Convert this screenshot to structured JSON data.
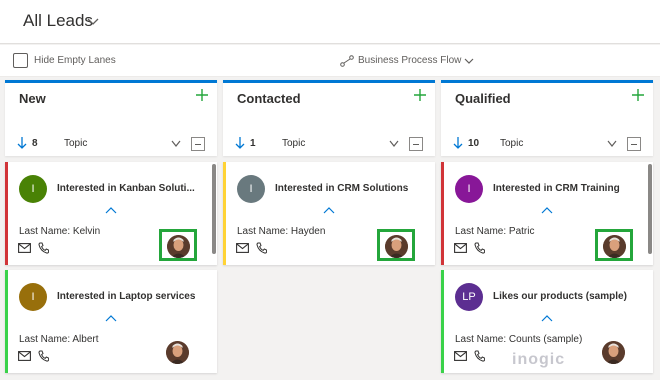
{
  "header": {
    "view_title": "All Leads"
  },
  "toolbar": {
    "hide_empty_lanes": "Hide Empty Lanes",
    "bpf_label": "Business Process Flow"
  },
  "colors": {
    "accent": "#0078d4",
    "highlight": "#24a63b",
    "red": "#d13438",
    "yellow": "#ffd335",
    "green": "#3ad24a"
  },
  "lanes": [
    {
      "title": "New",
      "count": "8",
      "sort_field": "Topic",
      "cards": [
        {
          "initials": "I",
          "avatar_color": "#498205",
          "title": "Interested in Kanban Soluti...",
          "field": "Last Name: Kelvin",
          "edge_color": "#d13438",
          "highlighted": true
        },
        {
          "initials": "I",
          "avatar_color": "#986f0b",
          "title": "Interested in Laptop services",
          "field": "Last Name: Albert",
          "edge_color": "#3ad24a",
          "highlighted": false
        }
      ]
    },
    {
      "title": "Contacted",
      "count": "1",
      "sort_field": "Topic",
      "cards": [
        {
          "initials": "I",
          "avatar_color": "#69797e",
          "title": "Interested in CRM Solutions",
          "field": "Last Name: Hayden",
          "edge_color": "#ffd335",
          "highlighted": true
        }
      ]
    },
    {
      "title": "Qualified",
      "count": "10",
      "sort_field": "Topic",
      "cards": [
        {
          "initials": "I",
          "avatar_color": "#881798",
          "title": "Interested in CRM Training",
          "field": "Last Name: Patric",
          "edge_color": "#d13438",
          "highlighted": true
        },
        {
          "initials": "LP",
          "avatar_color": "#5c2e91",
          "title": "Likes our products (sample)",
          "field": "Last Name: Counts (sample)",
          "edge_color": "#3ad24a",
          "highlighted": false
        }
      ]
    }
  ],
  "watermark": "inogic"
}
